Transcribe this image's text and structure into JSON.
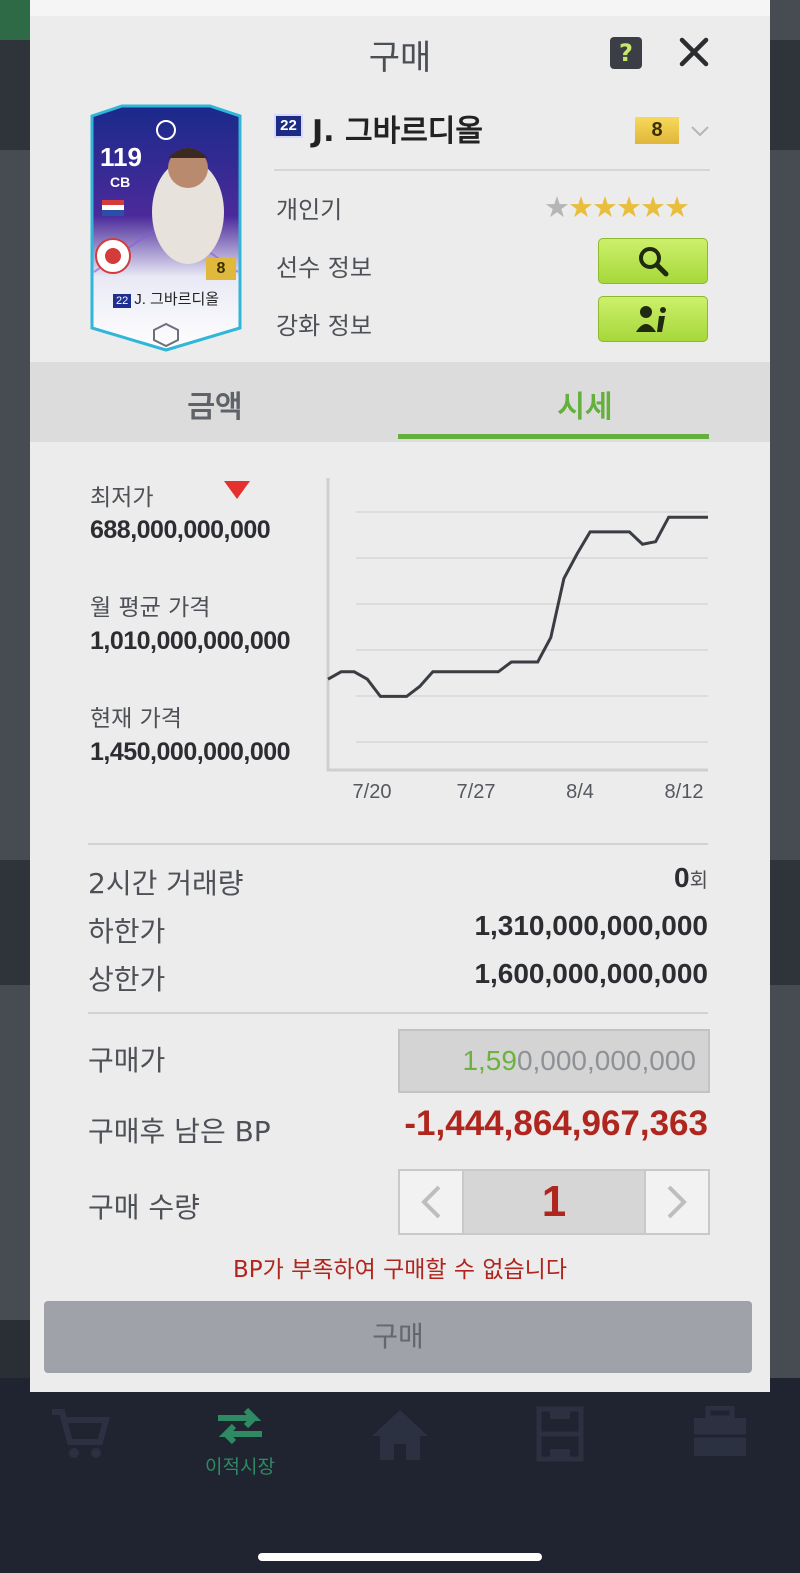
{
  "modal": {
    "title": "구매",
    "help_label": "?"
  },
  "card": {
    "ovr": "119",
    "position": "CB",
    "enhance_level": "8",
    "season": "22",
    "name": "J. 그바르디올"
  },
  "player": {
    "season": "22",
    "name": "J. 그바르디올",
    "grade": "8",
    "popularity_label": "개인기",
    "popularity_stars": 5,
    "popularity_max": 6,
    "info_label": "선수 정보",
    "enhance_label": "강화 정보"
  },
  "tabs": [
    {
      "label": "금액",
      "active": false
    },
    {
      "label": "시세",
      "active": true
    }
  ],
  "stats": {
    "lowest_label": "최저가",
    "lowest_value": "688,000,000,000",
    "monthly_avg_label": "월 평균 가격",
    "monthly_avg_value": "1,010,000,000,000",
    "current_label": "현재 가격",
    "current_value": "1,450,000,000,000"
  },
  "chart_data": {
    "type": "line",
    "x_tick_labels": [
      "7/20",
      "7/27",
      "8/4",
      "8/12"
    ],
    "y": [
      0.37,
      0.4,
      0.4,
      0.37,
      0.3,
      0.3,
      0.3,
      0.34,
      0.4,
      0.4,
      0.4,
      0.4,
      0.4,
      0.4,
      0.44,
      0.44,
      0.44,
      0.54,
      0.78,
      0.88,
      0.97,
      0.97,
      0.97,
      0.97,
      0.92,
      0.93,
      1.03,
      1.03,
      1.03,
      1.03
    ],
    "grid": true,
    "color": "#3a3d42"
  },
  "trade": {
    "volume_label": "2시간 거래량",
    "volume_value": "0",
    "volume_unit": "회",
    "lower_limit_label": "하한가",
    "lower_limit_value": "1,310,000,000,000",
    "upper_limit_label": "상한가",
    "upper_limit_value": "1,600,000,000,000",
    "buy_price_label": "구매가",
    "buy_price_typed": "1,59",
    "buy_price_rest": "0,000,000,000",
    "remaining_label": "구매후 남은 BP",
    "remaining_value": "-1,444,864,967,363",
    "quantity_label": "구매 수량",
    "quantity_value": "1",
    "error_message": "BP가 부족하여 구매할 수 없습니다",
    "buy_button_label": "구매"
  },
  "nav": {
    "items": [
      {
        "label": "",
        "icon": "cart-icon"
      },
      {
        "label": "이적시장",
        "icon": "transfer-icon"
      },
      {
        "label": "",
        "icon": "home-icon"
      },
      {
        "label": "",
        "icon": "pitch-icon"
      },
      {
        "label": "",
        "icon": "locker-icon"
      }
    ]
  },
  "colors": {
    "accent_green": "#63b03c",
    "error_red": "#b0261e",
    "button_green": "#b8e450"
  }
}
